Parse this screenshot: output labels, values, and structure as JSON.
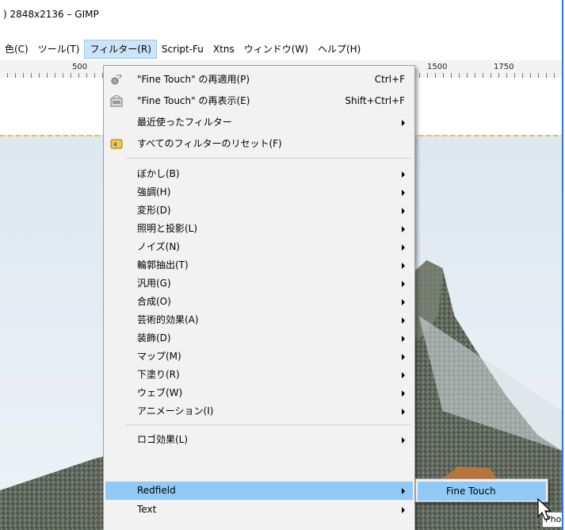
{
  "window": {
    "title": ") 2848x2136 – GIMP"
  },
  "menubar": {
    "items": [
      {
        "label": "色(C)",
        "active": false
      },
      {
        "label": "ツール(T)",
        "active": false
      },
      {
        "label": "フィルター(R)",
        "active": true
      },
      {
        "label": "Script-Fu",
        "active": false
      },
      {
        "label": "Xtns",
        "active": false
      },
      {
        "label": "ウィンドウ(W)",
        "active": false
      },
      {
        "label": "ヘルプ(H)",
        "active": false
      }
    ]
  },
  "ruler": {
    "labels": [
      "500",
      "1500",
      "1750"
    ]
  },
  "filters_menu": {
    "items": [
      {
        "label": "\"Fine Touch\" の再適用(P)",
        "shortcut": "Ctrl+F",
        "icon": "reapply-filter-icon"
      },
      {
        "label": "\"Fine Touch\" の再表示(E)",
        "shortcut": "Shift+Ctrl+F",
        "icon": "reshow-filter-icon"
      },
      {
        "label": "最近使ったフィルター",
        "submenu": true
      },
      {
        "label": "すべてのフィルターのリセット(F)",
        "icon": "reset-filters-icon"
      },
      {
        "label": "ぼかし(B)",
        "submenu": true
      },
      {
        "label": "強調(H)",
        "submenu": true
      },
      {
        "label": "変形(D)",
        "submenu": true
      },
      {
        "label": "照明と投影(L)",
        "submenu": true
      },
      {
        "label": "ノイズ(N)",
        "submenu": true
      },
      {
        "label": "輪郭抽出(T)",
        "submenu": true
      },
      {
        "label": "汎用(G)",
        "submenu": true
      },
      {
        "label": "合成(O)",
        "submenu": true
      },
      {
        "label": "芸術的効果(A)",
        "submenu": true
      },
      {
        "label": "装飾(D)",
        "submenu": true
      },
      {
        "label": "マップ(M)",
        "submenu": true
      },
      {
        "label": "下塗り(R)",
        "submenu": true
      },
      {
        "label": "ウェブ(W)",
        "submenu": true
      },
      {
        "label": "アニメーション(I)",
        "submenu": true
      },
      {
        "label": "ロゴ効果(L)",
        "submenu": true
      },
      {
        "label": "Redfield",
        "submenu": true,
        "highlighted": true
      },
      {
        "label": "Text",
        "submenu": true
      }
    ]
  },
  "redfield_submenu": {
    "items": [
      {
        "label": "Fine Touch",
        "highlighted": true
      }
    ]
  },
  "tooltip": {
    "text": "Pho"
  },
  "colors": {
    "highlight": "#91c9f7",
    "menubar_active": "#cce4f7",
    "guide": "#f2b200",
    "window_border": "#2b79d7"
  }
}
